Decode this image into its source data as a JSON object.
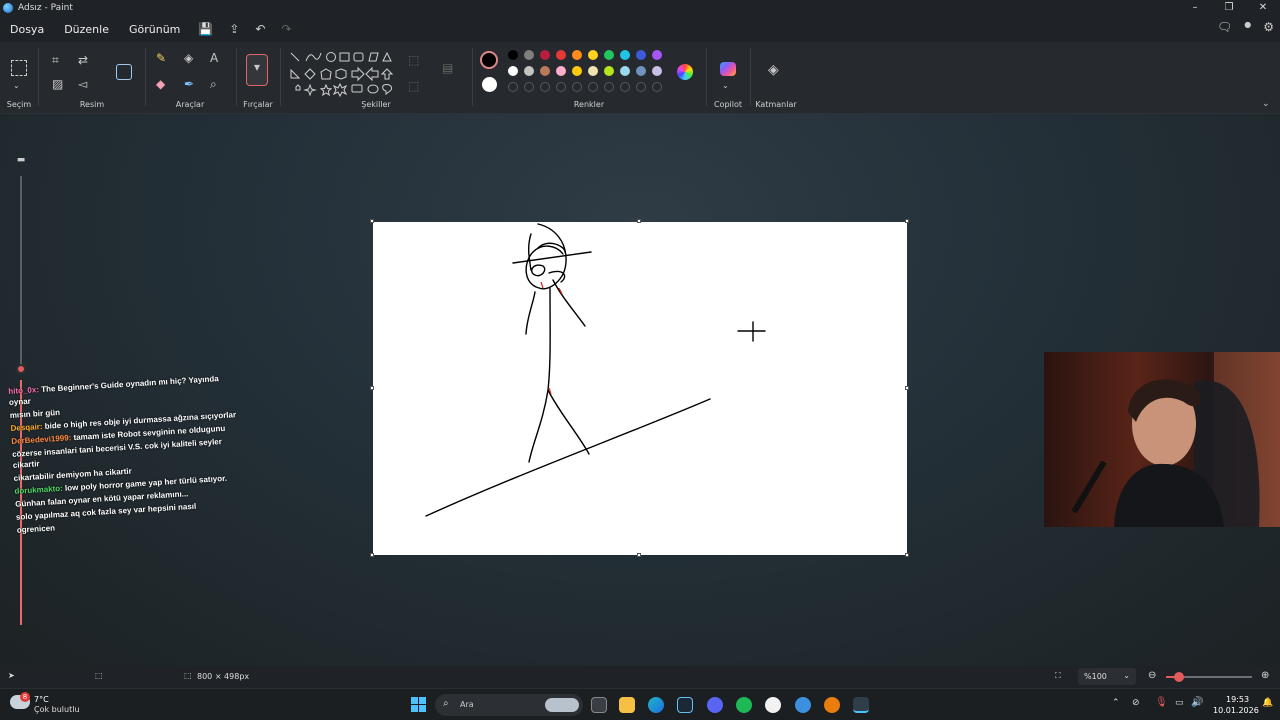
{
  "window": {
    "title": "Adsız - Paint"
  },
  "menu": {
    "file": "Dosya",
    "edit": "Düzenle",
    "view": "Görünüm"
  },
  "ribbon": {
    "selection": "Seçim",
    "image": "Resim",
    "tools": "Araçlar",
    "brushes": "Fırçalar",
    "shapes": "Şekiller",
    "colors": "Renkler",
    "copilot": "Copilot",
    "layers": "Katmanlar"
  },
  "palette": {
    "primary": "#000000",
    "secondary": "#ffffff",
    "row1": [
      "#000000",
      "#7f7f7f",
      "#b91c3c",
      "#e53935",
      "#ff8c1a",
      "#ffd21f",
      "#22c55e",
      "#22c3e6",
      "#3b5bdb",
      "#a855f7"
    ],
    "row2": [
      "#ffffff",
      "#c3c3c3",
      "#b97a57",
      "#ffaec9",
      "#ffc90e",
      "#efe4b0",
      "#b5e61d",
      "#99d9ea",
      "#7092be",
      "#c8bfe7"
    ]
  },
  "chat": {
    "messages": [
      {
        "user": "hito_0x:",
        "user_color": "#ff6fae",
        "text": "The Beginner's Guide oynadın mı hiç? Yayında oynar"
      },
      {
        "user": "",
        "user_color": "#ffffff",
        "text": "mısın bir gün"
      },
      {
        "user": "Desqair:",
        "user_color": "#ffb020",
        "text": "bide o high res obje iyi durmassa ağzına sıçıyorlar"
      },
      {
        "user": "DerBedevi1999:",
        "user_color": "#ff8a3d",
        "text": "tamam iste Robot sevginin ne oldugunu"
      },
      {
        "user": "",
        "user_color": "#ffffff",
        "text": "cözerse insanlari tani becerisi V.S. cok iyi kaliteli seyler cikartir"
      },
      {
        "user": "",
        "user_color": "#ffffff",
        "text": "cikartabilir demiyom ha cikartir"
      },
      {
        "user": "dorukmakto:",
        "user_color": "#4cd964",
        "text": "low poly horror game yap her türlü satıyor."
      },
      {
        "user": "",
        "user_color": "#ffffff",
        "text": "Günhan falan oynar en kötü yapar reklamını..."
      },
      {
        "user": "",
        "user_color": "#ff4d6d",
        "text": "solo yapılmaz aq cok fazla sey var hepsini nasıl"
      },
      {
        "user": "",
        "user_color": "#ffffff",
        "text": "ogrenicen"
      }
    ]
  },
  "status": {
    "canvas_size": "800 × 498px",
    "zoom": "%100",
    "zoom_fraction": 0.15
  },
  "taskbar": {
    "temperature": "7°C",
    "weather": "Çok bulutlu",
    "weather_badge": "8",
    "search": "Ara",
    "time": "19:53",
    "date": "10.01.2026"
  }
}
